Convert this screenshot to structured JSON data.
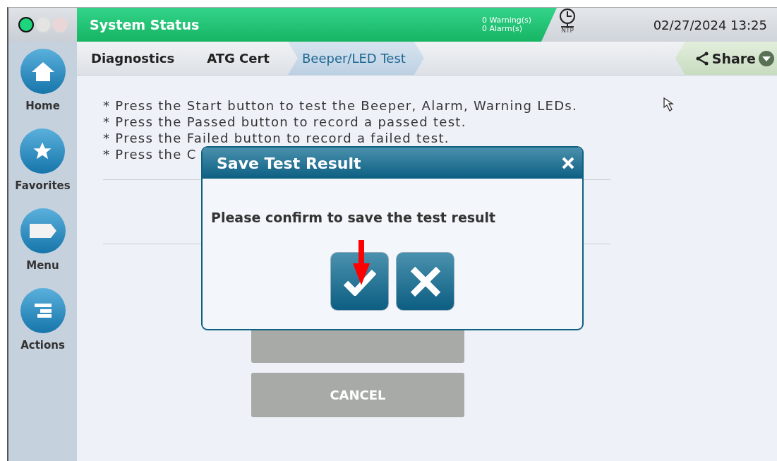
{
  "window_lights": [
    {
      "color": "#1ed47c"
    },
    {
      "color": "#e4e4e2"
    },
    {
      "color": "#ead6d6"
    }
  ],
  "header": {
    "title": "System Status",
    "warnings": "0 Warning(s)",
    "alarms": "0 Alarm(s)",
    "ntp_label": "NTP",
    "datetime": "02/27/2024 13:25"
  },
  "breadcrumbs": [
    {
      "label": "Diagnostics",
      "selected": false
    },
    {
      "label": "ATG Cert",
      "selected": false
    },
    {
      "label": "Beeper/LED Test",
      "selected": true
    }
  ],
  "share": {
    "label": "Share"
  },
  "sidebar": {
    "items": [
      {
        "label": "Home",
        "kind": "home"
      },
      {
        "label": "Favorites",
        "kind": "star"
      },
      {
        "label": "Menu",
        "kind": "tag"
      },
      {
        "label": "Actions",
        "kind": "list"
      }
    ]
  },
  "instructions": [
    "* Press the Start button to test the Beeper, Alarm, Warning LEDs.",
    "* Press the Passed button to record a passed test.",
    "* Press the Failed button to record a failed test.",
    "* Press the C"
  ],
  "background_buttons": [
    {
      "disabled": true
    },
    {
      "label": "CANCEL",
      "disabled": true
    }
  ],
  "dialog": {
    "title": "Save Test Result",
    "message": "Please confirm to save the test result",
    "buttons": [
      {
        "kind": "confirm"
      },
      {
        "kind": "cancel"
      }
    ]
  }
}
